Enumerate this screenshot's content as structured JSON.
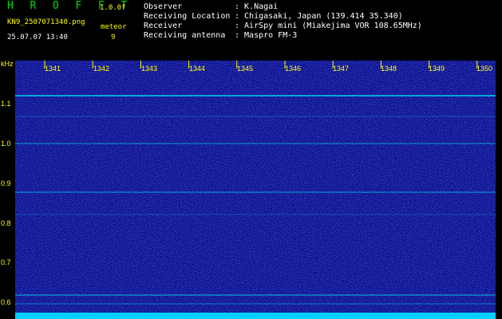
{
  "header": {
    "app_title": "H R O F F T",
    "version": "1.0.0f",
    "filename": "KN9_2507071340.png",
    "timestamp": "25.07.07 13:40",
    "meteor_label": "meteor",
    "meteor_count": "9"
  },
  "info": [
    {
      "label": "Observer",
      "value": ": K.Nagai"
    },
    {
      "label": "Receiving Location",
      "value": ": Chigasaki, Japan (139.414 35.340)"
    },
    {
      "label": "Receiver",
      "value": ": AirSpy mini (Miakejima VOR 108.65MHz)"
    },
    {
      "label": "Receiving antenna",
      "value": ": Maspro FM-3"
    }
  ],
  "axis": {
    "y_unit": "kHz",
    "y_ticks": [
      "1.1",
      "1.0",
      "0.9",
      "0.8",
      "0.7",
      "0.6"
    ],
    "x_ticks": [
      "1341",
      "1342",
      "1343",
      "1344",
      "1345",
      "1346",
      "1347",
      "1348",
      "1349",
      "1350"
    ]
  },
  "colors": {
    "background": "#000000",
    "spectrogram": "#0a0e8a",
    "signal_line": "#00ffff",
    "label_green": "#00e000",
    "label_yellow": "#ffff00"
  }
}
